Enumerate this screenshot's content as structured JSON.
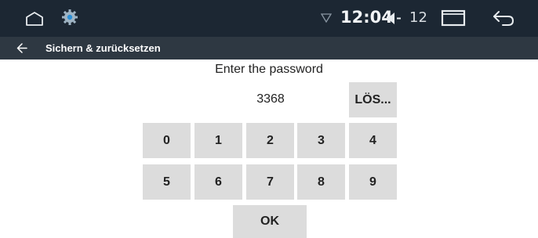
{
  "status_bar": {
    "time": "12:04",
    "volume_level": "12",
    "icons": [
      "home-icon",
      "settings-gear-icon",
      "signal-icon",
      "volume-icon",
      "recent-apps-icon",
      "back-icon"
    ]
  },
  "title_bar": {
    "title": "Sichern & zurücksetzen",
    "back_icon": "arrow-left-icon"
  },
  "dialog": {
    "prompt": "Enter the password",
    "password_value": "3368",
    "clear_label": "LÖS...",
    "keys_row1": [
      "0",
      "1",
      "2",
      "3",
      "4"
    ],
    "keys_row2": [
      "5",
      "6",
      "7",
      "8",
      "9"
    ],
    "ok_label": "OK"
  },
  "colors": {
    "status_bar_bg": "#1c2733",
    "title_bar_bg": "#2e3842",
    "key_bg": "#dcdcdc",
    "page_bg": "#ffffff"
  }
}
